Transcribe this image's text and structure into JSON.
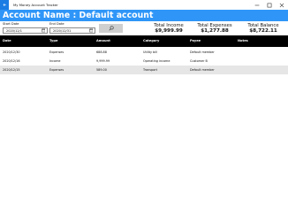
{
  "window": {
    "title": "My Money Account Tracker"
  },
  "header": {
    "account_title": "Account Name : Default account"
  },
  "filters": {
    "start_date_label": "Start Date",
    "start_date_value": "2020/12/1",
    "end_date_label": "End Date",
    "end_date_value": "2020/12/31",
    "search_icon": "search-icon",
    "calendar_icon": "calendar-icon"
  },
  "summary": {
    "total_income_label": "Total Income",
    "total_income_value": "$9,999.99",
    "total_expenses_label": "Total Expenses",
    "total_expenses_value": "$1,277.88",
    "total_balance_label": "Total Balance",
    "total_balance_value": "$8,722.11"
  },
  "table": {
    "columns": [
      "Date",
      "Type",
      "Amount",
      "Category",
      "Payee",
      "Notes"
    ],
    "rows": [
      [
        "2020/12/30",
        "Expenses",
        "688.88",
        "Utility bill",
        "Default member",
        ""
      ],
      [
        "2020/12/16",
        "Income",
        "9,999.99",
        "Operating income",
        "Customer B",
        ""
      ],
      [
        "2020/12/15",
        "Expenses",
        "589.00",
        "Transport",
        "Default member",
        ""
      ]
    ]
  },
  "colors": {
    "accent": "#2f96f8",
    "app_icon": "#1b7de4",
    "table_header": "#000000",
    "row_alt": "#e6e6e6",
    "search_button": "#cfcfcf"
  }
}
